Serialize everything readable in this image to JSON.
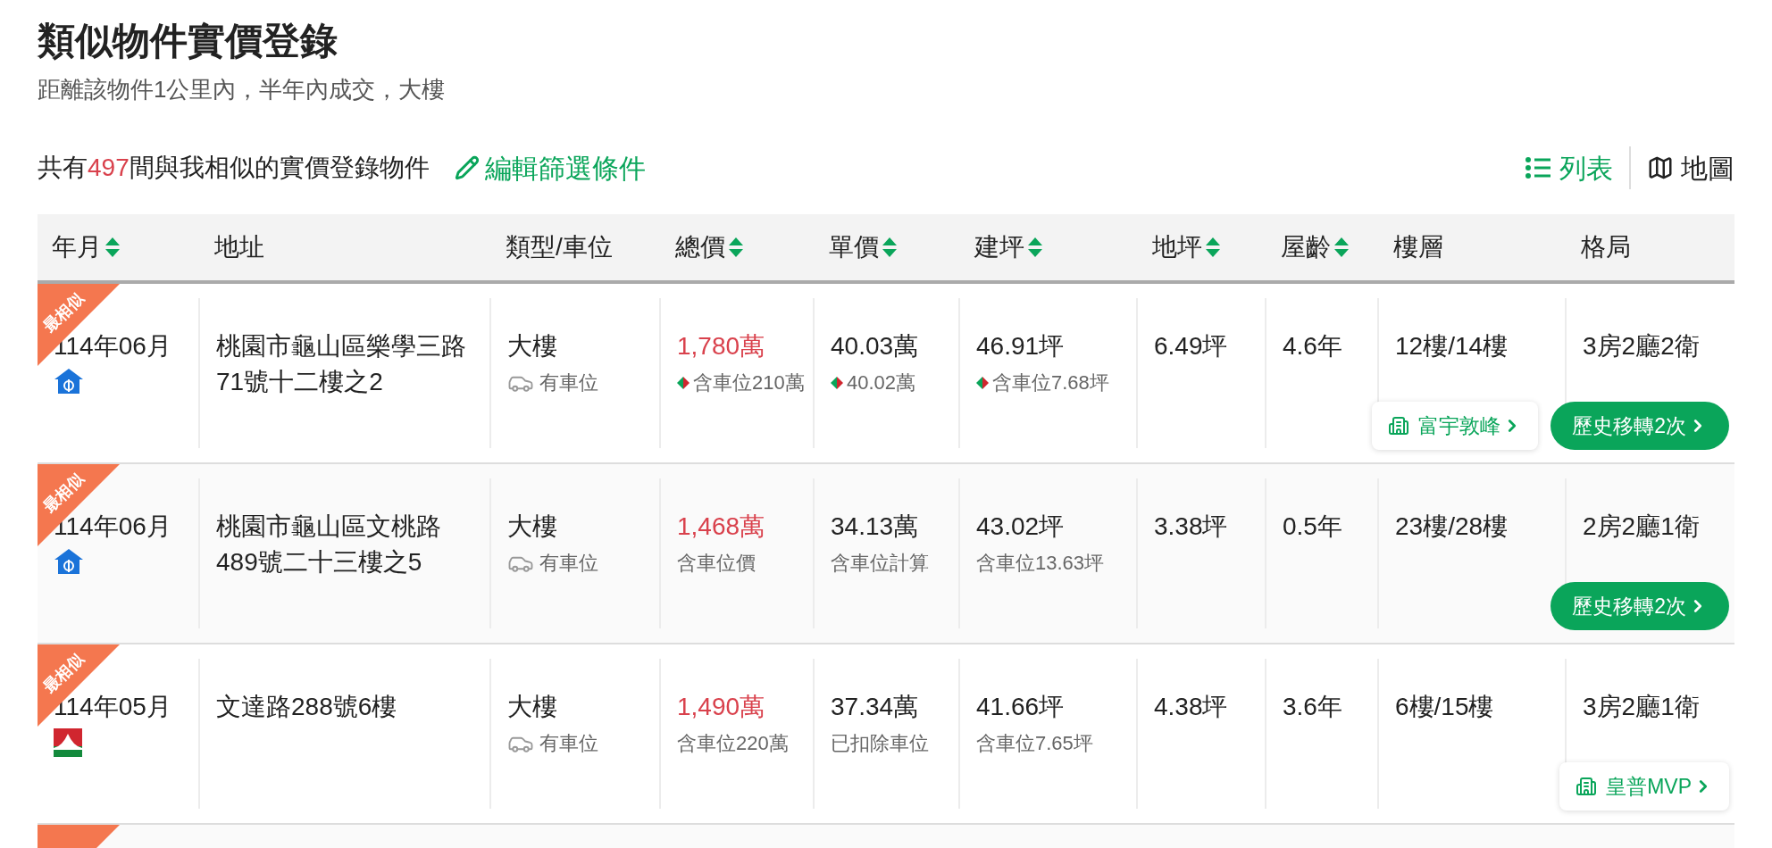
{
  "title": "類似物件實價登錄",
  "subtitle": "距離該物件1公里內，半年內成交，大樓",
  "summary": {
    "prefix": "共有",
    "count": "497",
    "suffix": "間與我相似的實價登錄物件",
    "edit_link": "編輯篩選條件"
  },
  "view_toggle": [
    {
      "label": "列表",
      "kind": "list",
      "selected": true
    },
    {
      "label": "地圖",
      "kind": "map",
      "selected": false
    }
  ],
  "table": {
    "columns": [
      {
        "label": "年月",
        "sortable": true
      },
      {
        "label": "地址",
        "sortable": false
      },
      {
        "label": "類型/車位",
        "sortable": false
      },
      {
        "label": "總價",
        "sortable": true
      },
      {
        "label": "單價",
        "sortable": true
      },
      {
        "label": "建坪",
        "sortable": true
      },
      {
        "label": "地坪",
        "sortable": true
      },
      {
        "label": "屋齡",
        "sortable": true
      },
      {
        "label": "樓層",
        "sortable": false
      },
      {
        "label": "格局",
        "sortable": false
      }
    ],
    "rows": [
      {
        "badge": "最相似",
        "date": "114年06月",
        "kind": "bank",
        "address": "桃園市龜山區樂學三路71號十二樓之2",
        "type": "大樓",
        "parking": "有車位",
        "total": "1,780萬",
        "total_note": "含車位210萬",
        "total_note_marked": true,
        "unit": "40.03萬",
        "unit_note": "40.02萬",
        "unit_note_marked": true,
        "building_area": "46.91坪",
        "building_note": "含車位7.68坪",
        "building_note_marked": true,
        "land_area": "6.49坪",
        "age": "4.6年",
        "floor": "12樓/14樓",
        "layout": "3房2廳2衛",
        "community": "富宇敦峰",
        "history": "歷史移轉2次"
      },
      {
        "badge": "最相似",
        "date": "114年06月",
        "kind": "bank",
        "address": "桃園市龜山區文桃路489號二十三樓之5",
        "type": "大樓",
        "parking": "有車位",
        "total": "1,468萬",
        "total_note": "含車位價",
        "total_note_marked": false,
        "unit": "34.13萬",
        "unit_note": "含車位計算",
        "unit_note_marked": false,
        "building_area": "43.02坪",
        "building_note": "含車位13.63坪",
        "building_note_marked": false,
        "land_area": "3.38坪",
        "age": "0.5年",
        "floor": "23樓/28樓",
        "layout": "2房2廳1衛",
        "history": "歷史移轉2次"
      },
      {
        "badge": "最相似",
        "date": "114年05月",
        "kind": "logo",
        "address": "文達路288號6樓",
        "type": "大樓",
        "parking": "有車位",
        "total": "1,490萬",
        "total_note": "含車位220萬",
        "total_note_marked": false,
        "unit": "37.34萬",
        "unit_note": "已扣除車位",
        "unit_note_marked": false,
        "building_area": "41.66坪",
        "building_note": "含車位7.65坪",
        "building_note_marked": false,
        "land_area": "4.38坪",
        "age": "3.6年",
        "floor": "6樓/15樓",
        "layout": "3房2廳1衛",
        "community": "皇普MVP"
      }
    ],
    "next_row_badge": true
  }
}
